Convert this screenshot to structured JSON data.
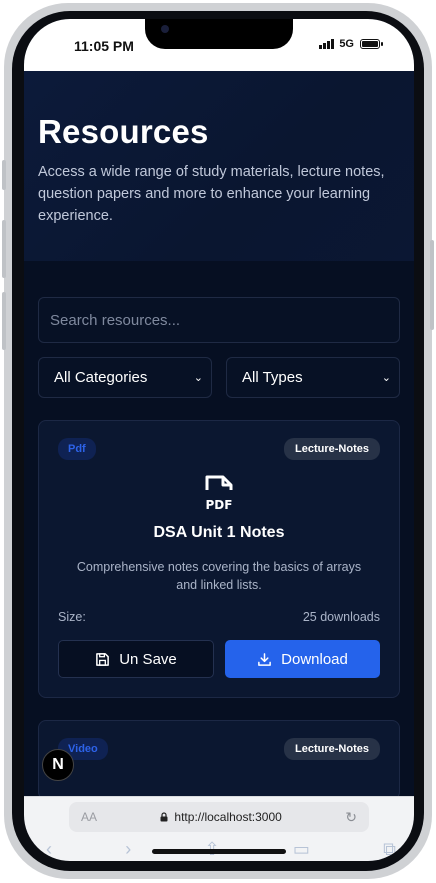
{
  "status_bar": {
    "time": "11:05 PM",
    "network": "5G"
  },
  "hero": {
    "title": "Resources",
    "description": "Access a wide range of study materials, lecture notes, question papers and more to enhance your learning experience."
  },
  "search": {
    "placeholder": "Search resources..."
  },
  "filters": {
    "category": "All Categories",
    "type": "All Types"
  },
  "cards": [
    {
      "type_badge": "Pdf",
      "category_badge": "Lecture-Notes",
      "title": "DSA Unit 1 Notes",
      "description": "Comprehensive notes covering the basics of arrays and linked lists.",
      "size_label": "Size:",
      "downloads": "25 downloads",
      "save_label": "Un Save",
      "download_label": "Download"
    },
    {
      "type_badge": "Video",
      "category_badge": "Lecture-Notes"
    }
  ],
  "dev_badge": "N",
  "browser": {
    "aa": "AA",
    "url": "http://localhost:3000"
  },
  "colors": {
    "accent": "#2563eb",
    "background": "#060f22",
    "card": "#0b1730"
  }
}
